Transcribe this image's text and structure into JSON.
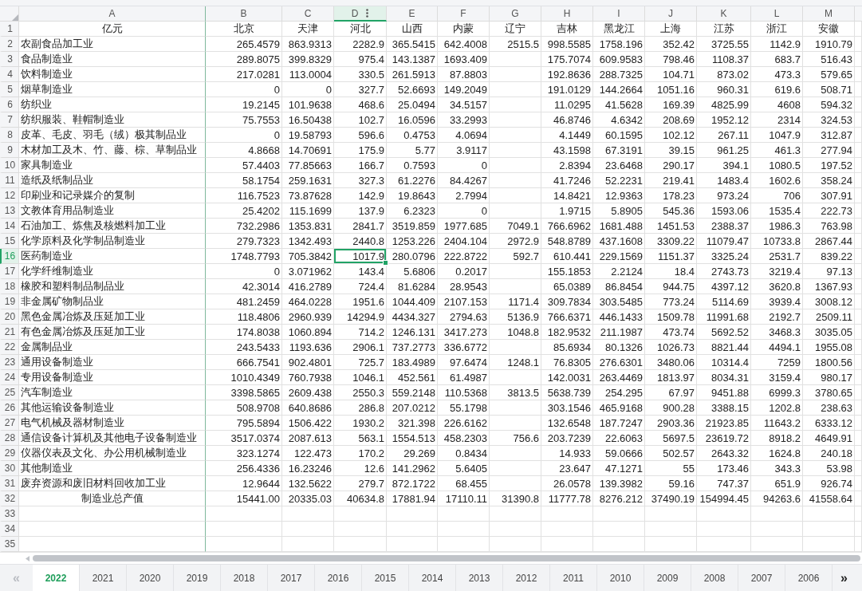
{
  "columns": [
    {
      "label": "A",
      "selected": false
    },
    {
      "label": "B",
      "selected": false
    },
    {
      "label": "C",
      "selected": false
    },
    {
      "label": "D",
      "selected": true
    },
    {
      "label": "E",
      "selected": false
    },
    {
      "label": "F",
      "selected": false
    },
    {
      "label": "G",
      "selected": false
    },
    {
      "label": "H",
      "selected": false
    },
    {
      "label": "I",
      "selected": false
    },
    {
      "label": "J",
      "selected": false
    },
    {
      "label": "K",
      "selected": false
    },
    {
      "label": "L",
      "selected": false
    },
    {
      "label": "M",
      "selected": false
    }
  ],
  "rows": [
    {
      "number": "1",
      "selected": false,
      "kind": "header",
      "cells": [
        "亿元",
        "北京",
        "天津",
        "河北",
        "山西",
        "内蒙",
        "辽宁",
        "吉林",
        "黑龙江",
        "上海",
        "江苏",
        "浙江",
        "安徽"
      ]
    },
    {
      "number": "2",
      "selected": false,
      "kind": "data",
      "cells": [
        "农副食品加工业",
        "265.4579",
        "863.9313",
        "2282.9",
        "365.5415",
        "642.4008",
        "2515.5",
        "998.5585",
        "1758.196",
        "352.42",
        "3725.55",
        "1142.9",
        "1910.79"
      ]
    },
    {
      "number": "3",
      "selected": false,
      "kind": "data",
      "cells": [
        "食品制造业",
        "289.8075",
        "399.8329",
        "975.4",
        "143.1387",
        "1693.409",
        null,
        "175.7074",
        "609.9583",
        "798.46",
        "1108.37",
        "683.7",
        "516.43"
      ]
    },
    {
      "number": "4",
      "selected": false,
      "kind": "data",
      "cells": [
        "饮料制造业",
        "217.0281",
        "113.0004",
        "330.5",
        "261.5913",
        "87.8803",
        null,
        "192.8636",
        "288.7325",
        "104.71",
        "873.02",
        "473.3",
        "579.65"
      ]
    },
    {
      "number": "5",
      "selected": false,
      "kind": "data",
      "cells": [
        "烟草制造业",
        "0",
        "0",
        "327.7",
        "52.6693",
        "149.2049",
        null,
        "191.0129",
        "144.2664",
        "1051.16",
        "960.31",
        "619.6",
        "508.71"
      ]
    },
    {
      "number": "6",
      "selected": false,
      "kind": "data",
      "cells": [
        "纺织业",
        "19.2145",
        "101.9638",
        "468.6",
        "25.0494",
        "34.5157",
        null,
        "11.0295",
        "41.5628",
        "169.39",
        "4825.99",
        "4608",
        "594.32"
      ]
    },
    {
      "number": "7",
      "selected": false,
      "kind": "data",
      "cells": [
        "纺织服装、鞋帽制造业",
        "75.7553",
        "16.50438",
        "102.7",
        "16.0596",
        "33.2993",
        null,
        "46.8746",
        "4.6342",
        "208.69",
        "1952.12",
        "2314",
        "324.53"
      ]
    },
    {
      "number": "8",
      "selected": false,
      "kind": "data",
      "cells": [
        "皮革、毛皮、羽毛（绒）极其制品业",
        "0",
        "19.58793",
        "596.6",
        "0.4753",
        "4.0694",
        null,
        "4.1449",
        "60.1595",
        "102.12",
        "267.11",
        "1047.9",
        "312.87"
      ]
    },
    {
      "number": "9",
      "selected": false,
      "kind": "data",
      "cells": [
        "木材加工及木、竹、藤、棕、草制品业",
        "4.8668",
        "14.70691",
        "175.9",
        "5.77",
        "3.9117",
        null,
        "43.1598",
        "67.3191",
        "39.15",
        "961.25",
        "461.3",
        "277.94"
      ]
    },
    {
      "number": "10",
      "selected": false,
      "kind": "data",
      "cells": [
        "家具制造业",
        "57.4403",
        "77.85663",
        "166.7",
        "0.7593",
        "0",
        null,
        "2.8394",
        "23.6468",
        "290.17",
        "394.1",
        "1080.5",
        "197.52"
      ]
    },
    {
      "number": "11",
      "selected": false,
      "kind": "data",
      "cells": [
        "造纸及纸制品业",
        "58.1754",
        "259.1631",
        "327.3",
        "61.2276",
        "84.4267",
        null,
        "41.7246",
        "52.2231",
        "219.41",
        "1483.4",
        "1602.6",
        "358.24"
      ]
    },
    {
      "number": "12",
      "selected": false,
      "kind": "data",
      "cells": [
        "印刷业和记录媒介的复制",
        "116.7523",
        "73.87628",
        "142.9",
        "19.8643",
        "2.7994",
        null,
        "14.8421",
        "12.9363",
        "178.23",
        "973.24",
        "706",
        "307.91"
      ]
    },
    {
      "number": "13",
      "selected": false,
      "kind": "data",
      "cells": [
        "文教体育用品制造业",
        "25.4202",
        "115.1699",
        "137.9",
        "6.2323",
        "0",
        null,
        "1.9715",
        "5.8905",
        "545.36",
        "1593.06",
        "1535.4",
        "222.73"
      ]
    },
    {
      "number": "14",
      "selected": false,
      "kind": "data",
      "cells": [
        "石油加工、炼焦及核燃料加工业",
        "732.2986",
        "1353.831",
        "2841.7",
        "3519.859",
        "1977.685",
        "7049.1",
        "766.6962",
        "1681.488",
        "1451.53",
        "2388.37",
        "1986.3",
        "763.98"
      ]
    },
    {
      "number": "15",
      "selected": false,
      "kind": "data",
      "cells": [
        "化学原料及化学制品制造业",
        "279.7323",
        "1342.493",
        "2440.8",
        "1253.226",
        "2404.104",
        "2972.9",
        "548.8789",
        "437.1608",
        "3309.22",
        "11079.47",
        "10733.8",
        "2867.44"
      ]
    },
    {
      "number": "16",
      "selected": true,
      "kind": "data",
      "cells": [
        "医药制造业",
        "1748.7793",
        "705.3842",
        "1017.9",
        "280.0796",
        "222.8722",
        "592.7",
        "610.441",
        "229.1569",
        "1151.37",
        "3325.24",
        "2531.7",
        "839.22"
      ]
    },
    {
      "number": "17",
      "selected": false,
      "kind": "data",
      "cells": [
        "化学纤维制造业",
        "0",
        "3.071962",
        "143.4",
        "5.6806",
        "0.2017",
        null,
        "155.1853",
        "2.2124",
        "18.4",
        "2743.73",
        "3219.4",
        "97.13"
      ]
    },
    {
      "number": "18",
      "selected": false,
      "kind": "data",
      "cells": [
        "橡胶和塑料制品制品业",
        "42.3014",
        "416.2789",
        "724.4",
        "81.6284",
        "28.9543",
        null,
        "65.0389",
        "86.8454",
        "944.75",
        "4397.12",
        "3620.8",
        "1367.93"
      ]
    },
    {
      "number": "19",
      "selected": false,
      "kind": "data",
      "cells": [
        "非金属矿物制品业",
        "481.2459",
        "464.0228",
        "1951.6",
        "1044.409",
        "2107.153",
        "1171.4",
        "309.7834",
        "303.5485",
        "773.24",
        "5114.69",
        "3939.4",
        "3008.12"
      ]
    },
    {
      "number": "20",
      "selected": false,
      "kind": "data",
      "cells": [
        "黑色金属冶炼及压延加工业",
        "118.4806",
        "2960.939",
        "14294.9",
        "4434.327",
        "2794.63",
        "5136.9",
        "766.6371",
        "446.1433",
        "1509.78",
        "11991.68",
        "2192.7",
        "2509.11"
      ]
    },
    {
      "number": "21",
      "selected": false,
      "kind": "data",
      "cells": [
        "有色金属冶炼及压延加工业",
        "174.8038",
        "1060.894",
        "714.2",
        "1246.131",
        "3417.273",
        "1048.8",
        "182.9532",
        "211.1987",
        "473.74",
        "5692.52",
        "3468.3",
        "3035.05"
      ]
    },
    {
      "number": "22",
      "selected": false,
      "kind": "data",
      "cells": [
        "金属制品业",
        "243.5433",
        "1193.636",
        "2906.1",
        "737.2773",
        "336.6772",
        null,
        "85.6934",
        "80.1326",
        "1026.73",
        "8821.44",
        "4494.1",
        "1955.08"
      ]
    },
    {
      "number": "23",
      "selected": false,
      "kind": "data",
      "cells": [
        "通用设备制造业",
        "666.7541",
        "902.4801",
        "725.7",
        "183.4989",
        "97.6474",
        "1248.1",
        "76.8305",
        "276.6301",
        "3480.06",
        "10314.4",
        "7259",
        "1800.56"
      ]
    },
    {
      "number": "24",
      "selected": false,
      "kind": "data",
      "cells": [
        "专用设备制造业",
        "1010.4349",
        "760.7938",
        "1046.1",
        "452.561",
        "61.4987",
        null,
        "142.0031",
        "263.4469",
        "1813.97",
        "8034.31",
        "3159.4",
        "980.17"
      ]
    },
    {
      "number": "25",
      "selected": false,
      "kind": "data",
      "cells": [
        "汽车制造业",
        "3398.5865",
        "2609.438",
        "2550.3",
        "559.2148",
        "110.5368",
        "3813.5",
        "5638.739",
        "254.295",
        "67.97",
        "9451.88",
        "6999.3",
        "3780.65"
      ]
    },
    {
      "number": "26",
      "selected": false,
      "kind": "data",
      "cells": [
        "其他运输设备制造业",
        "508.9708",
        "640.8686",
        "286.8",
        "207.0212",
        "55.1798",
        null,
        "303.1546",
        "465.9168",
        "900.28",
        "3388.15",
        "1202.8",
        "238.63"
      ]
    },
    {
      "number": "27",
      "selected": false,
      "kind": "data",
      "cells": [
        "电气机械及器材制造业",
        "795.5894",
        "1506.422",
        "1930.2",
        "321.398",
        "226.6162",
        null,
        "132.6548",
        "187.7247",
        "2903.36",
        "21923.85",
        "11643.2",
        "6333.12"
      ]
    },
    {
      "number": "28",
      "selected": false,
      "kind": "data",
      "cells": [
        "通信设备计算机及其他电子设备制造业",
        "3517.0374",
        "2087.613",
        "563.1",
        "1554.513",
        "458.2303",
        "756.6",
        "203.7239",
        "22.6063",
        "5697.5",
        "23619.72",
        "8918.2",
        "4649.91"
      ]
    },
    {
      "number": "29",
      "selected": false,
      "kind": "data",
      "cells": [
        "仪器仪表及文化、办公用机械制造业",
        "323.1274",
        "122.473",
        "170.2",
        "29.269",
        "0.8434",
        null,
        "14.933",
        "59.0666",
        "502.57",
        "2643.32",
        "1624.8",
        "240.18"
      ]
    },
    {
      "number": "30",
      "selected": false,
      "kind": "data",
      "cells": [
        "其他制造业",
        "256.4336",
        "16.23246",
        "12.6",
        "141.2962",
        "5.6405",
        null,
        "23.647",
        "47.1271",
        "55",
        "173.46",
        "343.3",
        "53.98"
      ]
    },
    {
      "number": "31",
      "selected": false,
      "kind": "data",
      "cells": [
        "废弃资源和废旧材料回收加工业",
        "12.9644",
        "132.5622",
        "279.7",
        "872.1722",
        "68.455",
        null,
        "26.0578",
        "139.3982",
        "59.16",
        "747.37",
        "651.9",
        "926.74"
      ]
    },
    {
      "number": "32",
      "selected": false,
      "kind": "total",
      "cells": [
        "制造业总产值",
        "15441.00",
        "20335.03",
        "40634.8",
        "17881.94",
        "17110.11",
        "31390.8",
        "11777.78",
        "8276.212",
        "37490.19",
        "154994.45",
        "94263.6",
        "41558.64"
      ]
    },
    {
      "number": "33",
      "selected": false,
      "kind": "empty"
    },
    {
      "number": "34",
      "selected": false,
      "kind": "empty"
    },
    {
      "number": "35",
      "selected": false,
      "kind": "empty"
    }
  ],
  "sheet_nav": [
    {
      "label": "«",
      "disabled": true
    },
    {
      "label": "»",
      "disabled": false
    }
  ],
  "sheets": [
    {
      "label": "2022",
      "selected": true
    },
    {
      "label": "2021",
      "selected": false
    },
    {
      "label": "2020",
      "selected": false
    },
    {
      "label": "2019",
      "selected": false
    },
    {
      "label": "2018",
      "selected": false
    },
    {
      "label": "2017",
      "selected": false
    },
    {
      "label": "2016",
      "selected": false
    },
    {
      "label": "2015",
      "selected": false
    },
    {
      "label": "2014",
      "selected": false
    },
    {
      "label": "2013",
      "selected": false
    },
    {
      "label": "2012",
      "selected": false
    },
    {
      "label": "2011",
      "selected": false
    },
    {
      "label": "2010",
      "selected": false
    },
    {
      "label": "2009",
      "selected": false
    },
    {
      "label": "2008",
      "selected": false
    },
    {
      "label": "2007",
      "selected": false
    },
    {
      "label": "2006",
      "selected": false
    }
  ]
}
